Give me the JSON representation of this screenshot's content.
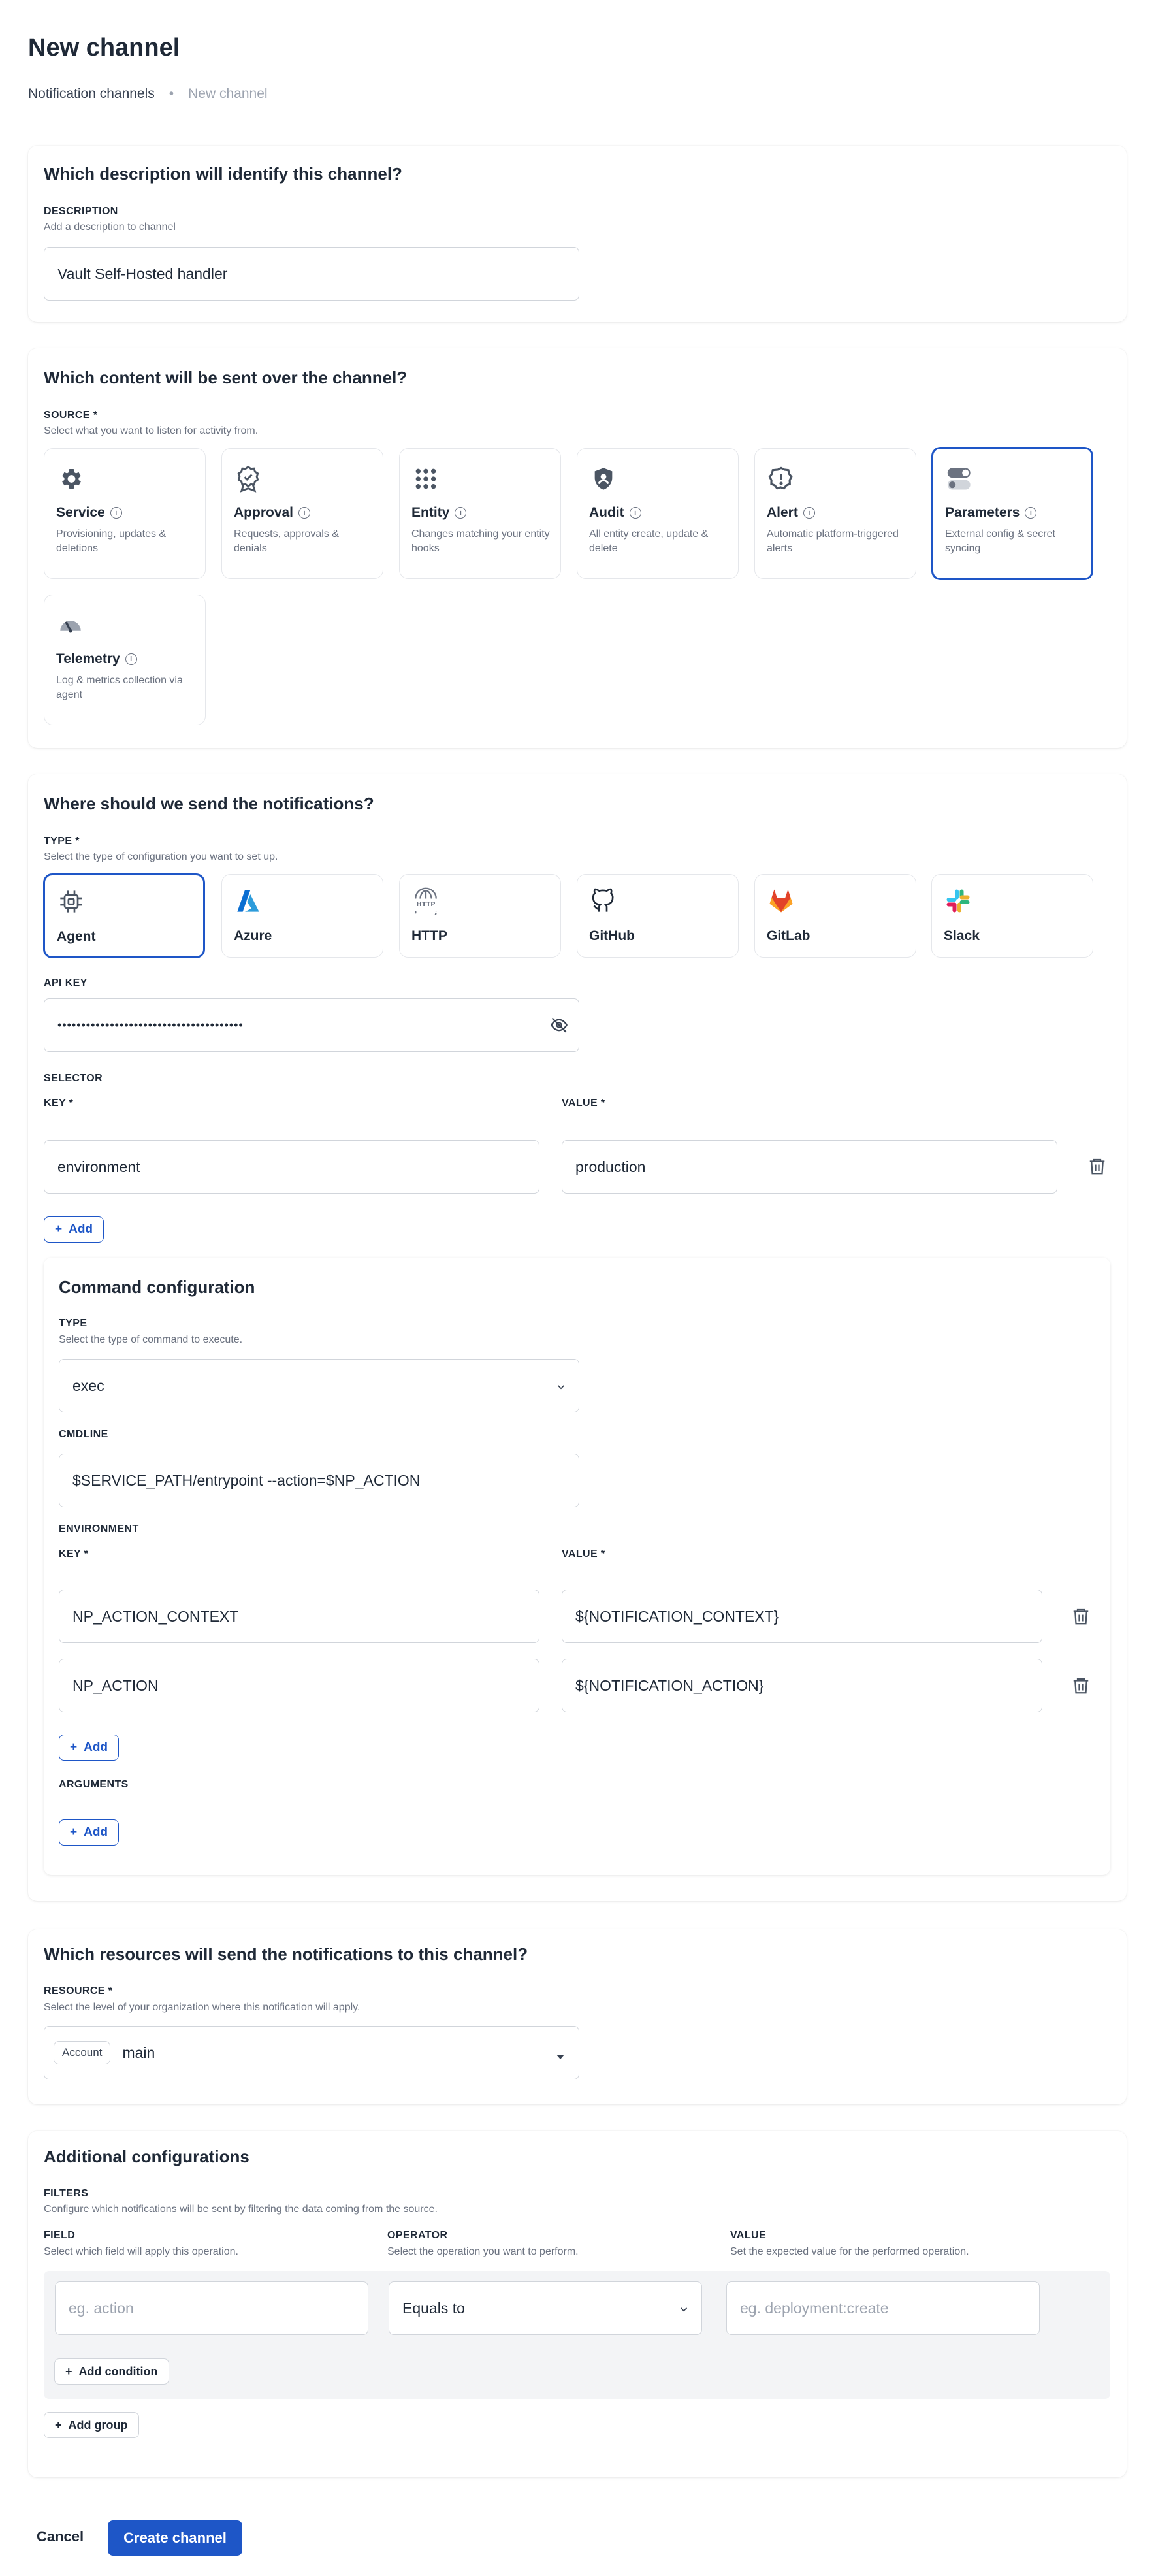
{
  "header": {
    "title": "New channel",
    "breadcrumb": [
      "Notification channels",
      "New channel"
    ]
  },
  "description_section": {
    "title": "Which description will identify this channel?",
    "label": "DESCRIPTION",
    "hint": "Add a description to channel",
    "value": "Vault Self-Hosted handler"
  },
  "content_section": {
    "title": "Which content will be sent over the channel?",
    "label": "SOURCE *",
    "hint": "Select what you want to listen for activity from.",
    "sources": [
      {
        "name": "Service",
        "desc": "Provisioning, updates & deletions",
        "icon": "gear-icon"
      },
      {
        "name": "Approval",
        "desc": "Requests, approvals & denials",
        "icon": "badge-check-icon"
      },
      {
        "name": "Entity",
        "desc": "Changes matching your entity hooks",
        "icon": "grid-dots-icon"
      },
      {
        "name": "Audit",
        "desc": "All entity create, update & delete",
        "icon": "shield-icon"
      },
      {
        "name": "Alert",
        "desc": "Automatic platform-triggered alerts",
        "icon": "alert-octagon-icon"
      },
      {
        "name": "Parameters",
        "desc": "External config & secret syncing",
        "icon": "toggle-icon",
        "selected": true
      },
      {
        "name": "Telemetry",
        "desc": "Log & metrics collection via agent",
        "icon": "gauge-icon"
      }
    ]
  },
  "destination_section": {
    "title": "Where should we send the notifications?",
    "label": "TYPE *",
    "hint": "Select the type of configuration you want to set up.",
    "types": [
      {
        "name": "Agent",
        "icon": "chip-icon",
        "selected": true
      },
      {
        "name": "Azure",
        "icon": "azure-icon"
      },
      {
        "name": "HTTP",
        "icon": "http-globe-icon"
      },
      {
        "name": "GitHub",
        "icon": "github-icon"
      },
      {
        "name": "GitLab",
        "icon": "gitlab-icon"
      },
      {
        "name": "Slack",
        "icon": "slack-icon"
      }
    ],
    "api_key_label": "API KEY",
    "api_key_value": "•••••••••••••••••••••••••••••••••••••••",
    "selector_label": "SELECTOR",
    "key_label": "KEY *",
    "value_label": "VALUE *",
    "selector_key": "environment",
    "selector_value": "production",
    "add_label": "Add",
    "command": {
      "title": "Command configuration",
      "type_label": "TYPE",
      "type_hint": "Select the type of command to execute.",
      "type_value": "exec",
      "cmdline_label": "CMDLINE",
      "cmdline_value": "$SERVICE_PATH/entrypoint --action=$NP_ACTION",
      "env_label": "ENVIRONMENT",
      "env": [
        {
          "key": "NP_ACTION_CONTEXT",
          "value": "${NOTIFICATION_CONTEXT}"
        },
        {
          "key": "NP_ACTION",
          "value": "${NOTIFICATION_ACTION}"
        }
      ],
      "arguments_label": "ARGUMENTS"
    }
  },
  "resources_section": {
    "title": "Which resources will send the notifications to this channel?",
    "label": "RESOURCE *",
    "hint": "Select the level of your organization where this notification will apply.",
    "chip": "Account",
    "value": "main"
  },
  "additional_section": {
    "title": "Additional configurations",
    "filters_label": "FILTERS",
    "filters_hint": "Configure which notifications will be sent by filtering the data coming from the source.",
    "field_label": "FIELD",
    "field_hint": "Select which field will apply this operation.",
    "operator_label": "OPERATOR",
    "operator_hint": "Select the operation you want to perform.",
    "value_label": "VALUE",
    "value_hint": "Set the expected value for the performed operation.",
    "field_placeholder": "eg. action",
    "operator_value": "Equals to",
    "value_placeholder": "eg. deployment:create",
    "add_condition": "Add condition",
    "add_group": "Add group"
  },
  "footer": {
    "cancel": "Cancel",
    "create": "Create channel"
  },
  "colors": {
    "accent": "#1e56c7"
  }
}
